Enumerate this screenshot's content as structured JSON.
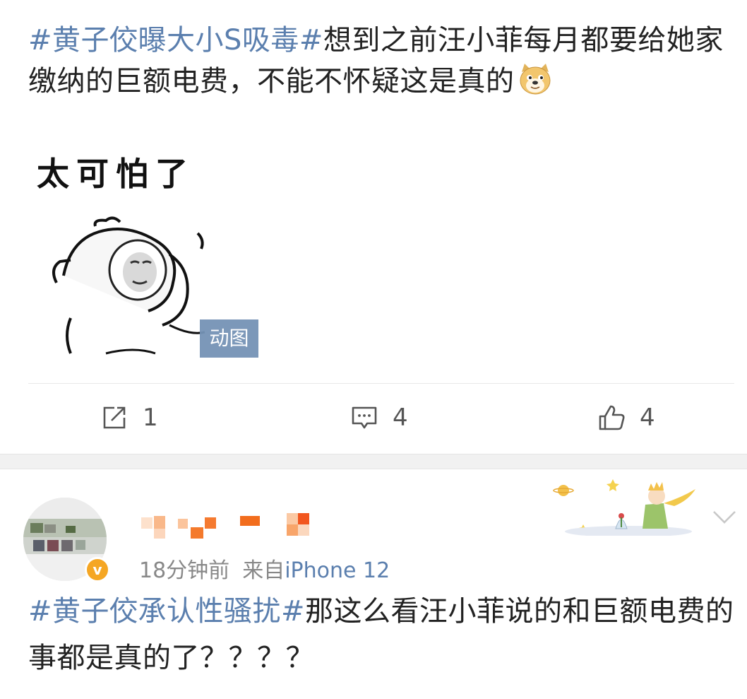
{
  "post1": {
    "hashtag": "#黄子佼曝大小S吸毒#",
    "body": "想到之前汪小菲每月都要给她家缴纳的巨额电费，不能不怀疑这是真的",
    "emoji": "doge",
    "meme_caption": "太可怕了",
    "gif_badge": "动图",
    "repost_count": "1",
    "comment_count": "4",
    "like_count": "4"
  },
  "post2": {
    "time": "18分钟前",
    "source_prefix": "来自",
    "device": "iPhone 12",
    "verified_mark": "v",
    "hashtag": "#黄子佼承认性骚扰#",
    "body": "那这么看汪小菲说的和巨额电费的事都是真的了？？？？"
  },
  "colors": {
    "hashtag": "#5b7fae",
    "verified": "#f5a623",
    "gif_badge": "#7593b6"
  },
  "icons": [
    "repost-icon",
    "comment-icon",
    "like-icon",
    "chevron-down-icon",
    "doge-emoji-icon",
    "verified-badge-icon"
  ]
}
